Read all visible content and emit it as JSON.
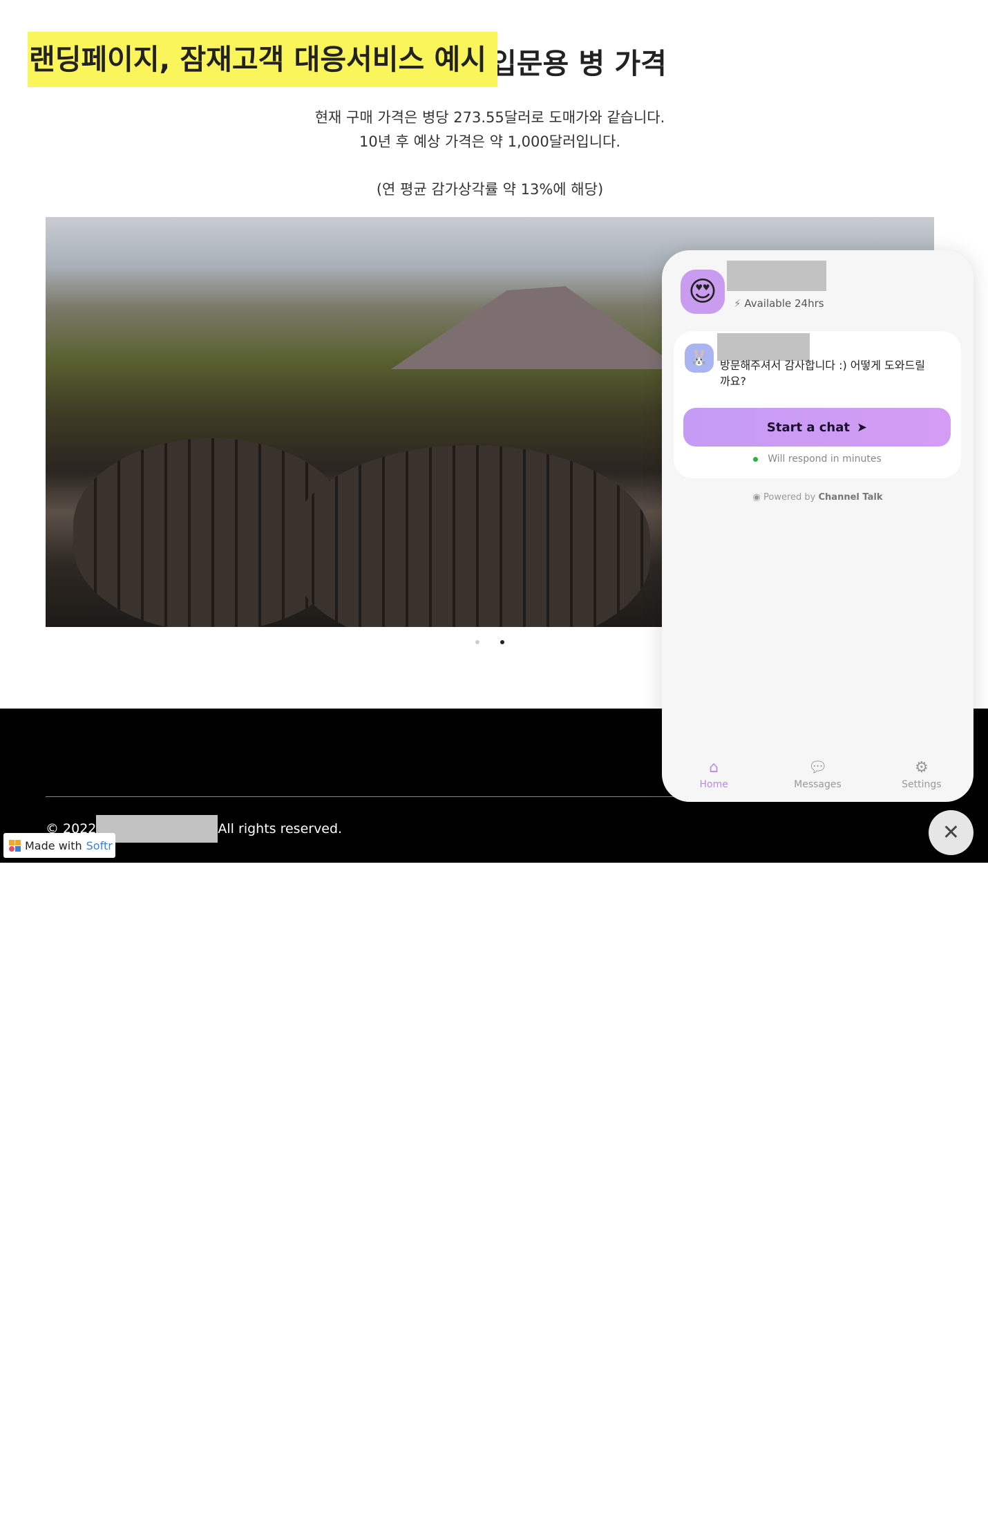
{
  "title": {
    "highlight": "랜딩페이지, 잠재고객 대응서비스 예시",
    "rest": "입문용 병 가격"
  },
  "description": {
    "line1": "현재 구매 가격은 병당 273.55달러로 도매가와 같습니다.",
    "line2": "10년 후 예상 가격은 약 1,000달러입니다.",
    "note": "(연 평균 감가상각률 약 13%에 해당)"
  },
  "carousel": {
    "slides": 2,
    "active": 2
  },
  "footer": {
    "copyright_prefix": "© 2022",
    "copyright_suffix": "All rights reserved.",
    "badge": {
      "made_with": "Made with",
      "brand": "Softr"
    }
  },
  "chat_widget": {
    "avatar_emoji": "😍",
    "status": "Available 24hrs",
    "bot_emoji": "🐰",
    "message": "방문해주셔서 감사합니다 :) 어떻게 도와드릴까요?",
    "start_label": "Start a chat",
    "respond_text": "Will respond in minutes",
    "powered_by": "Powered by",
    "powered_brand": "Channel Talk",
    "nav": [
      {
        "label": "Home",
        "icon": "home-icon"
      },
      {
        "label": "Messages",
        "icon": "chat-bubble-icon"
      },
      {
        "label": "Settings",
        "icon": "gear-icon"
      }
    ],
    "accent": "#c49cf5",
    "online_color": "#2ab24a"
  }
}
